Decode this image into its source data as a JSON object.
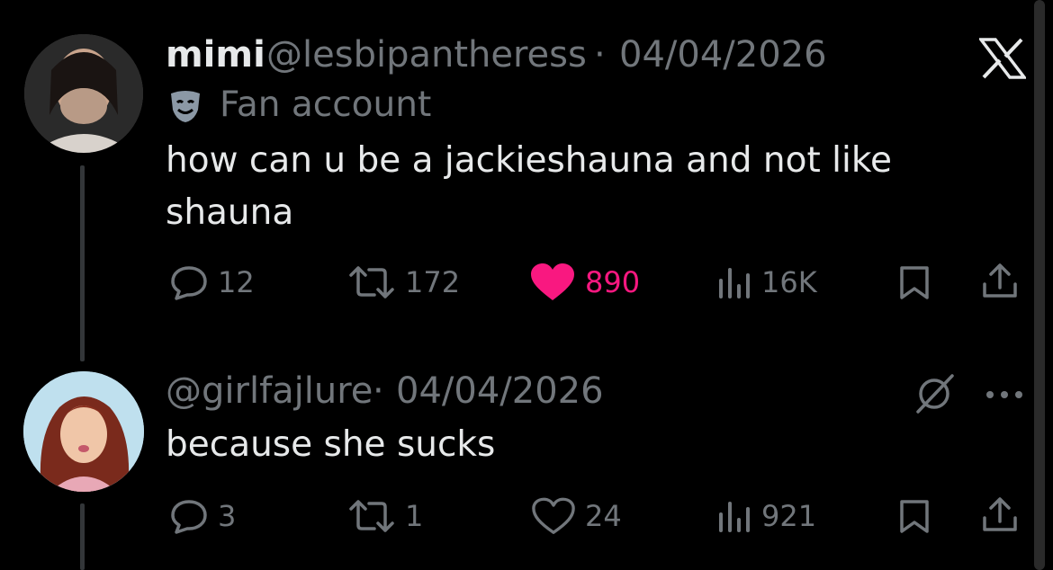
{
  "post": {
    "display_name": "mimi",
    "handle": "@lesbipantheress",
    "separator": "·",
    "date": "04/04/2026",
    "label_icon": "theater-mask-icon",
    "label": "Fan account",
    "text": "how can u be a jackieshauna and not like shauna",
    "replies": "12",
    "reposts": "172",
    "likes": "890",
    "views": "16K",
    "liked": true,
    "like_color": "#f91880"
  },
  "reply": {
    "handle": "@girlfajlure",
    "separator": "·",
    "date": "04/04/2026",
    "text": "because she sucks",
    "replies": "3",
    "reposts": "1",
    "likes": "24",
    "views": "921"
  },
  "icons": {
    "platform_logo": "x-logo-icon",
    "reply": "reply-bubble-icon",
    "repost": "repost-icon",
    "like": "heart-icon",
    "views": "views-chart-icon",
    "bookmark": "bookmark-icon",
    "share": "share-icon",
    "grok": "grok-icon",
    "more": "more-dots-icon"
  }
}
